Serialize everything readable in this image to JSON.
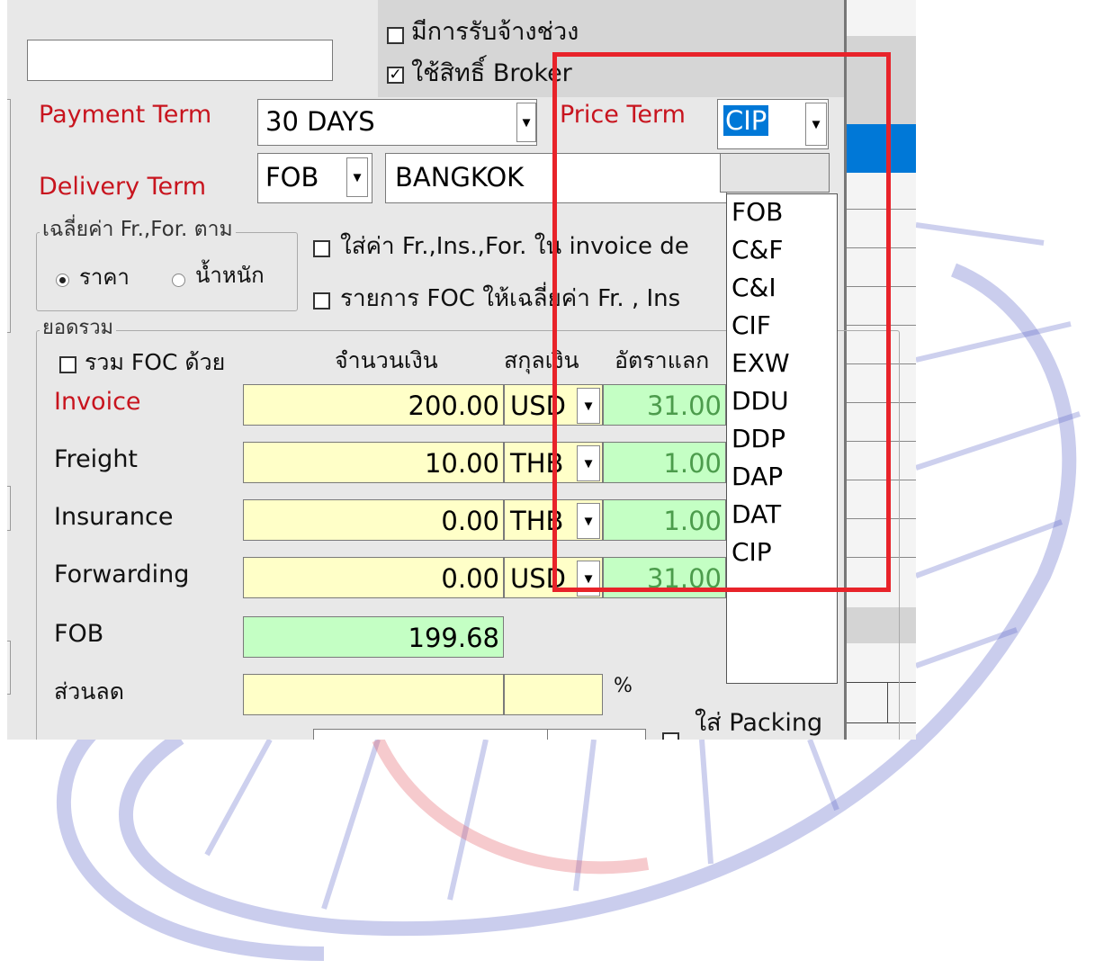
{
  "header": {
    "subcontract_label": "มีการรับจ้างช่วง",
    "broker_label": "ใช้สิทธิ์ Broker",
    "broker_checked": "✓"
  },
  "terms": {
    "payment_label": "Payment Term",
    "payment_value": "30 DAYS",
    "price_label": "Price Term",
    "price_value": "CIP",
    "delivery_label": "Delivery Term",
    "delivery_code": "FOB",
    "delivery_place": "BANGKOK"
  },
  "allocation": {
    "group_title": "เฉลี่ยค่า Fr.,For. ตาม",
    "radio_price": "ราคา",
    "radio_weight": "น้ำหนัก",
    "opt1": "ใส่ค่า Fr.,Ins.,For. ใน invoice de",
    "opt2": "รายการ FOC ให้เฉลี่ยค่า Fr. , Ins"
  },
  "totals": {
    "group_title": "ยอดรวม",
    "include_foc": "รวม FOC ด้วย",
    "col_amount": "จำนวนเงิน",
    "col_currency": "สกุลเงิน",
    "col_rate": "อัตราแลก",
    "rows": [
      {
        "label": "Invoice",
        "amount": "200.00",
        "currency": "USD",
        "rate": "31.00"
      },
      {
        "label": "Freight",
        "amount": "10.00",
        "currency": "THB",
        "rate": "1.00"
      },
      {
        "label": "Insurance",
        "amount": "0.00",
        "currency": "THB",
        "rate": "1.00"
      },
      {
        "label": "Forwarding",
        "amount": "0.00",
        "currency": "USD",
        "rate": "31.00"
      }
    ],
    "fob_label": "FOB",
    "fob_value": "199.68",
    "discount_label": "ส่วนลด",
    "percent": "%",
    "packing_label": "ใส่ Packing"
  },
  "price_term_options": [
    "FOB",
    "C&F",
    "C&I",
    "CIF",
    "EXW",
    "DDU",
    "DDP",
    "DAP",
    "DAT",
    "CIP"
  ],
  "colors": {
    "highlight": "#e8232a",
    "accent_label": "#c8141e",
    "selection": "#0078d7"
  }
}
